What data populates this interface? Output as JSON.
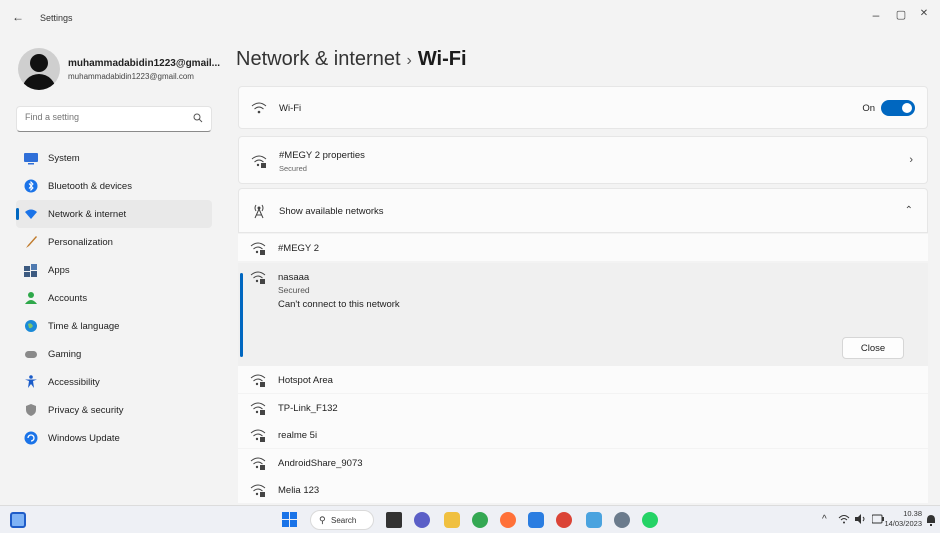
{
  "window": {
    "back_icon": "back-arrow-icon",
    "title": "Settings",
    "minimize": "–",
    "maximize": "▢",
    "close": "✕"
  },
  "profile": {
    "name": "muhammadabidin1223@gmail...",
    "email": "muhammadabidin1223@gmail.com"
  },
  "search": {
    "placeholder": "Find a setting",
    "icon": "search-icon"
  },
  "sidebar": {
    "items": [
      {
        "label": "System",
        "icon": "system-monitor-icon",
        "color": "#2f6fd8"
      },
      {
        "label": "Bluetooth & devices",
        "icon": "bluetooth-icon",
        "color": "#1a73e8"
      },
      {
        "label": "Network & internet",
        "icon": "wifi-network-icon",
        "color": "#1a73e8",
        "active": true
      },
      {
        "label": "Personalization",
        "icon": "paintbrush-icon",
        "color": "#c07a2b"
      },
      {
        "label": "Apps",
        "icon": "apps-icon",
        "color": "#3c5a80"
      },
      {
        "label": "Accounts",
        "icon": "accounts-person-icon",
        "color": "#2ea84a"
      },
      {
        "label": "Time & language",
        "icon": "globe-clock-icon",
        "color": "#1a8ad8"
      },
      {
        "label": "Gaming",
        "icon": "gamepad-icon",
        "color": "#8a8a8a"
      },
      {
        "label": "Accessibility",
        "icon": "accessibility-icon",
        "color": "#1a5bc8"
      },
      {
        "label": "Privacy & security",
        "icon": "shield-icon",
        "color": "#8a8a8a"
      },
      {
        "label": "Windows Update",
        "icon": "windows-update-icon",
        "color": "#1a73e8"
      }
    ]
  },
  "header": {
    "breadcrumb": "Network & internet",
    "separator": "›",
    "current": "Wi-Fi"
  },
  "wifi": {
    "label": "Wi-Fi",
    "toggle_label": "On",
    "toggle_on": true
  },
  "properties": {
    "label": "#MEGY 2 properties",
    "sub": "Secured"
  },
  "available": {
    "label": "Show available networks",
    "expanded": true
  },
  "networks": {
    "connected": "#MEGY 2",
    "selected": {
      "name": "nasaaa",
      "security": "Secured",
      "error": "Can't connect to this network",
      "close_label": "Close"
    },
    "others": [
      "Hotspot Area",
      "TP-Link_F132",
      "realme 5i",
      "AndroidShare_9073",
      "Melia 123"
    ]
  },
  "taskbar": {
    "search_label": "Search",
    "time": "10.38",
    "date": "14/03/2023",
    "tray_up": "^",
    "apps": [
      {
        "icon": "file-explorer-icon",
        "color": "#f2b934"
      },
      {
        "icon": "teams-chat-icon",
        "color": "#5b5fc7"
      },
      {
        "icon": "folder-icon",
        "color": "#f0c040"
      },
      {
        "icon": "chrome-icon",
        "color": "#34a853"
      },
      {
        "icon": "firefox-icon",
        "color": "#ff7139"
      },
      {
        "icon": "store-icon",
        "color": "#2a7de1"
      },
      {
        "icon": "chrome-alt-icon",
        "color": "#db4437"
      },
      {
        "icon": "photos-icon",
        "color": "#4aa3df"
      },
      {
        "icon": "settings-gear-icon",
        "color": "#6b7b8c"
      },
      {
        "icon": "whatsapp-icon",
        "color": "#25d366"
      }
    ]
  }
}
